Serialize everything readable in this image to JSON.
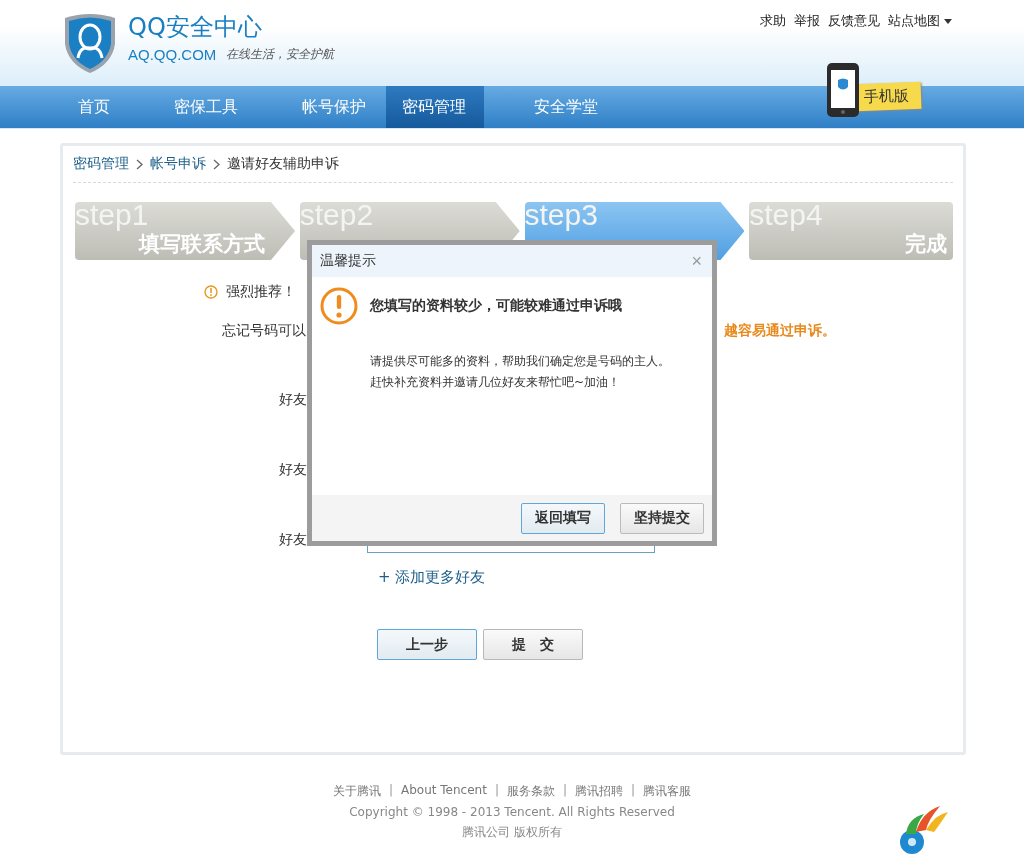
{
  "header": {
    "logo_title": "QQ安全中心",
    "logo_domain": "AQ.QQ.COM",
    "slogan": "在线生活，安全护航",
    "top_links": [
      "求助",
      "举报",
      "反馈意见",
      "站点地图"
    ],
    "mobile_badge": "手机版"
  },
  "nav": [
    {
      "label": "首页",
      "selected": false
    },
    {
      "label": "密保工具",
      "selected": false
    },
    {
      "label": "帐号保护",
      "selected": false
    },
    {
      "label": "密码管理",
      "selected": true
    },
    {
      "label": "安全学堂",
      "selected": false
    }
  ],
  "breadcrumb": [
    "密码管理",
    "帐号申诉",
    "邀请好友辅助申诉"
  ],
  "steps": [
    {
      "number": "step1",
      "label": "填写联系方式",
      "selected": false
    },
    {
      "number": "step2",
      "selected": false
    },
    {
      "number": "step3",
      "selected": true
    },
    {
      "number": "step4",
      "label": "完成",
      "selected": false
    }
  ],
  "notice": "强烈推荐！",
  "intro": {
    "text": "忘记号码可以",
    "highlight": "越容易通过申诉。"
  },
  "friend_fields": [
    {
      "label": "好友"
    },
    {
      "label": "好友"
    },
    {
      "label": "好友"
    }
  ],
  "add_more": "+ 添加更多好友",
  "buttons": [
    {
      "label": "上一步",
      "selected": true
    },
    {
      "label": "提 交",
      "selected": false
    }
  ],
  "dialog": {
    "title": "温馨提示",
    "close": "×",
    "heading": "您填写的资料较少，可能较难通过申诉哦",
    "body": [
      "请提供尽可能多的资料，帮助我们确定您是号码的主人。",
      "赶快补充资料并邀请几位好友来帮忙吧~加油！"
    ],
    "buttons": [
      {
        "label": "返回填写",
        "selected": true
      },
      {
        "label": "坚持提交",
        "selected": false
      }
    ]
  },
  "footer": {
    "separator": "|",
    "links": [
      "关于腾讯",
      "About Tencent",
      "服务条款",
      "腾讯招聘",
      "腾讯客服"
    ],
    "copyright": "Copyright © 1998 - 2013 Tencent. All Rights Reserved",
    "company": "腾讯公司 版权所有"
  }
}
